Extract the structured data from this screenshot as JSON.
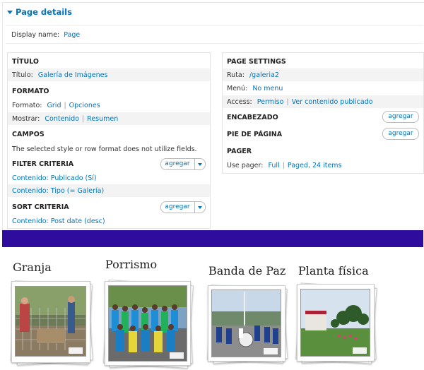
{
  "page_details": {
    "title": "Page details"
  },
  "display_name": {
    "label": "Display name:",
    "value": "Page"
  },
  "left": {
    "titulo": {
      "header": "TÍTULO",
      "label": "Título:",
      "value": "Galería de Imágenes"
    },
    "formato": {
      "header": "FORMATO",
      "formato_label": "Formato:",
      "formato_value": "Grid",
      "formato_opts": "Opciones",
      "mostrar_label": "Mostrar:",
      "mostrar_value": "Contenido",
      "mostrar_opts": "Resumen"
    },
    "campos": {
      "header": "CAMPOS",
      "note": "The selected style or row format does not utilize fields."
    },
    "filter": {
      "header": "FILTER CRITERIA",
      "add": "agregar",
      "items": [
        "Contenido: Publicado (Sí)",
        "Contenido: Tipo (= Galería)"
      ]
    },
    "sort": {
      "header": "SORT CRITERIA",
      "add": "agregar",
      "items": [
        "Contenido: Post date (desc)"
      ]
    }
  },
  "right": {
    "settings": {
      "header": "PAGE SETTINGS",
      "ruta_label": "Ruta:",
      "ruta_value": "/galeria2",
      "menu_label": "Menú:",
      "menu_value": "No menu",
      "access_label": "Access:",
      "access_value": "Permiso",
      "access_opt": "Ver contenido publicado"
    },
    "encabezado": {
      "header": "ENCABEZADO",
      "add": "agregar"
    },
    "pie": {
      "header": "PIE DE PÁGINA",
      "add": "agregar"
    },
    "pager": {
      "header": "PAGER",
      "label": "Use pager:",
      "value": "Full",
      "opt": "Paged, 24 items"
    }
  },
  "colors": {
    "link": "#0074bd",
    "band": "#2e0d9c"
  },
  "gallery": {
    "items": [
      {
        "caption": "Granja",
        "icon": "farm-photo"
      },
      {
        "caption": "Porrismo",
        "icon": "cheerleaders-photo"
      },
      {
        "caption": "Banda de Paz",
        "icon": "marching-band-photo"
      },
      {
        "caption": "Planta física",
        "icon": "campus-photo"
      }
    ]
  }
}
